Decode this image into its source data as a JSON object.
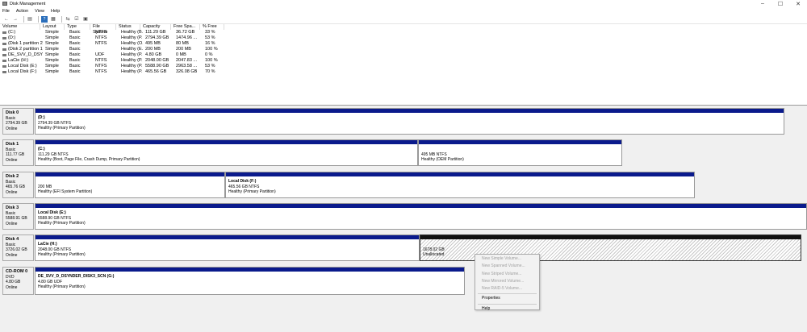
{
  "window": {
    "title": "Disk Management"
  },
  "menu": [
    "File",
    "Action",
    "View",
    "Help"
  ],
  "volume_list": {
    "columns": [
      "Volume",
      "Layout",
      "Type",
      "File System",
      "Status",
      "Capacity",
      "Free Spa...",
      "% Free"
    ],
    "rows": [
      [
        "(C:)",
        "Simple",
        "Basic",
        "NTFS",
        "Healthy (B...",
        "111.29 GB",
        "36.72 GB",
        "33 %"
      ],
      [
        "(D:)",
        "Simple",
        "Basic",
        "NTFS",
        "Healthy (P...",
        "2794.39 GB",
        "1474.96 ...",
        "53 %"
      ],
      [
        "(Disk 1 partition 2)",
        "Simple",
        "Basic",
        "NTFS",
        "Healthy (O...",
        "495 MB",
        "80 MB",
        "16 %"
      ],
      [
        "(Disk 2 partition 1)",
        "Simple",
        "Basic",
        "",
        "Healthy (E...",
        "200 MB",
        "200 MB",
        "100 %"
      ],
      [
        "DE_SVV_D_DSYNDE...",
        "Simple",
        "Basic",
        "UDF",
        "Healthy (P...",
        "4.80 GB",
        "0 MB",
        "0 %"
      ],
      [
        "LaCie (H:)",
        "Simple",
        "Basic",
        "NTFS",
        "Healthy (P...",
        "2048.00 GB",
        "2047.83 ...",
        "100 %"
      ],
      [
        "Local Disk (E:)",
        "Simple",
        "Basic",
        "NTFS",
        "Healthy (P...",
        "5588.90 GB",
        "2963.58 ...",
        "53 %"
      ],
      [
        "Local Disk (F:)",
        "Simple",
        "Basic",
        "NTFS",
        "Healthy (P...",
        "465.56 GB",
        "326.08 GB",
        "70 %"
      ]
    ]
  },
  "disks": [
    {
      "name": "Disk 0",
      "type": "Basic",
      "size": "2794.39 GB",
      "state": "Online",
      "partitions": [
        {
          "label": "(D:)",
          "size": "2794.39 GB NTFS",
          "status": "Healthy (Primary Partition)"
        }
      ]
    },
    {
      "name": "Disk 1",
      "type": "Basic",
      "size": "111.77 GB",
      "state": "Online",
      "partitions": [
        {
          "label": "(C:)",
          "size": "111.29 GB NTFS",
          "status": "Healthy (Boot, Page File, Crash Dump, Primary Partition)"
        },
        {
          "label": "",
          "size": "495 MB NTFS",
          "status": "Healthy (OEM Partition)"
        }
      ]
    },
    {
      "name": "Disk 2",
      "type": "Basic",
      "size": "465.76 GB",
      "state": "Online",
      "partitions": [
        {
          "label": "",
          "size": "200 MB",
          "status": "Healthy (EFI System Partition)"
        },
        {
          "label": "Local Disk  (F:)",
          "size": "465.56 GB NTFS",
          "status": "Healthy (Primary Partition)"
        }
      ]
    },
    {
      "name": "Disk 3",
      "type": "Basic",
      "size": "5588.91 GB",
      "state": "Online",
      "partitions": [
        {
          "label": "Local Disk  (E:)",
          "size": "5588.90 GB NTFS",
          "status": "Healthy (Primary Partition)"
        }
      ]
    },
    {
      "name": "Disk 4",
      "type": "Basic",
      "size": "3726.02 GB",
      "state": "Online",
      "partitions": [
        {
          "label": "LaCie  (H:)",
          "size": "2048.00 GB NTFS",
          "status": "Healthy (Primary Partition)"
        },
        {
          "label": "",
          "size": "1678.02 GB",
          "status": "Unallocated"
        }
      ]
    },
    {
      "name": "CD-ROM 0",
      "type": "DVD",
      "size": "4.80 GB",
      "state": "Online",
      "partitions": [
        {
          "label": "DE_SVV_D_DSYNDER_DISK3_SCN  (G:)",
          "size": "4.80 GB UDF",
          "status": "Healthy (Primary Partition)"
        }
      ]
    }
  ],
  "context_menu": {
    "items": [
      "New Simple Volume...",
      "New Spanned Volume...",
      "New Striped Volume...",
      "New Mirrored Volume...",
      "New RAID-5 Volume...",
      "Properties",
      "Help"
    ]
  },
  "colors": {
    "primary_bar": "#0a1a8c",
    "unallocated_bar": "#111111"
  },
  "icons": [
    "disk-management-icon",
    "back-icon",
    "forward-icon",
    "properties-icon",
    "help-icon",
    "minimize-icon",
    "maximize-icon",
    "close-icon"
  ]
}
